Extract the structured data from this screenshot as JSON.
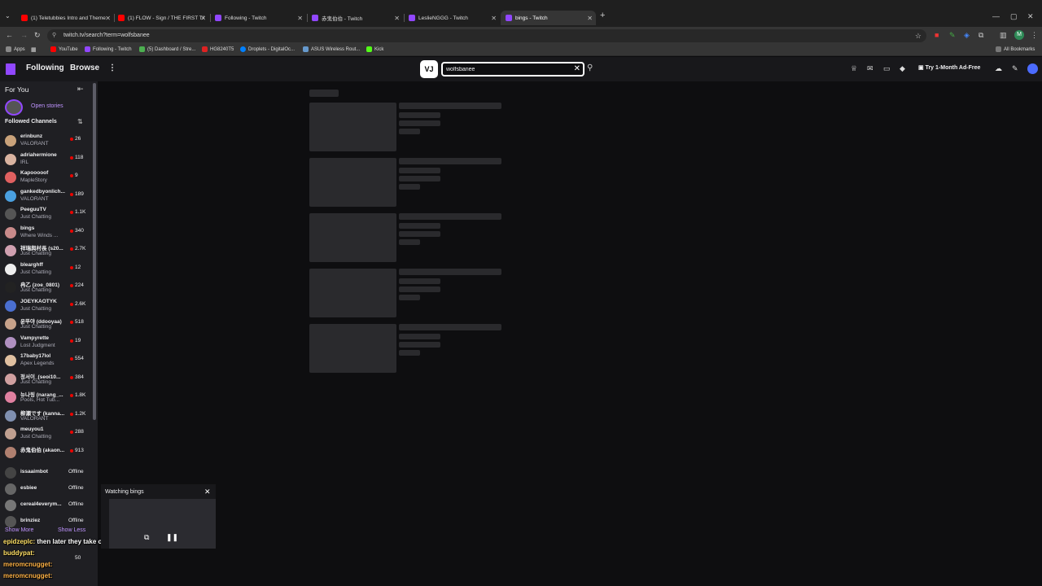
{
  "browser": {
    "tabs": [
      {
        "label": "(1) Teletubbies Intro and Theme",
        "color": "#ff0000"
      },
      {
        "label": "(1) FLOW - Sign / THE FIRST TAKE",
        "color": "#ff0000"
      },
      {
        "label": "Following - Twitch",
        "color": "#9147ff"
      },
      {
        "label": "赤鬼伯伯 - Twitch",
        "color": "#9147ff"
      },
      {
        "label": "LeslieNGGG - Twitch",
        "color": "#9147ff"
      },
      {
        "label": "bings - Twitch",
        "color": "#9147ff"
      }
    ],
    "url": "twitch.tv/search?term=wolfsbanee",
    "profile_initial": "M",
    "bookmarks": [
      {
        "label": "Apps"
      },
      {
        "label": "YouTube"
      },
      {
        "label": "Following - Twitch"
      },
      {
        "label": "(5) Dashboard / Stre..."
      },
      {
        "label": "HG8240T5"
      },
      {
        "label": "Droplets - DigitalOc..."
      },
      {
        "label": "ASUS Wireless Rout..."
      },
      {
        "label": "Kick"
      }
    ],
    "all_bookmarks": "All Bookmarks"
  },
  "nav": {
    "following": "Following",
    "browse": "Browse",
    "more": "⋮",
    "search_value": "wolfsbanee",
    "search_placeholder": "Search",
    "ad_free": "Try 1-Month Ad-Free",
    "badge": "VJ"
  },
  "sidebar": {
    "for_you": "For You",
    "open_stories": "Open stories",
    "followed_channels": "Followed Channels",
    "channels": [
      {
        "name": "erinbunz",
        "game": "VALORANT",
        "viewers": "26",
        "av": "#c9a27a"
      },
      {
        "name": "adriahermione",
        "game": "IRL",
        "viewers": "118",
        "av": "#d9b3a0"
      },
      {
        "name": "Kapooooof",
        "game": "MapleStory",
        "viewers": "9",
        "av": "#e06060"
      },
      {
        "name": "gankedbyonlich...",
        "game": "VALORANT",
        "viewers": "189",
        "av": "#4aa0e0"
      },
      {
        "name": "PeeguuTV",
        "game": "Just Chatting",
        "viewers": "1.1K",
        "av": "#555555"
      },
      {
        "name": "bings",
        "game": "Where Winds ...",
        "viewers": "340",
        "av": "#c98a8a"
      },
      {
        "name": "祥瑞與村長 (s20...",
        "game": "Just Chatting",
        "viewers": "2.7K",
        "av": "#d0a0b0"
      },
      {
        "name": "blearghff",
        "game": "Just Chatting",
        "viewers": "12",
        "av": "#eeeeee"
      },
      {
        "name": "冉乙 (zoe_0801)",
        "game": "Just Chatting",
        "viewers": "224",
        "av": "#222222"
      },
      {
        "name": "JOEYKAOTYK",
        "game": "Just Chatting",
        "viewers": "2.6K",
        "av": "#4a6fd0"
      },
      {
        "name": "윤뚜야 (ddooyaa)",
        "game": "Just Chatting",
        "viewers": "518",
        "av": "#c7a28a"
      },
      {
        "name": "Vampyrette",
        "game": "Lost Judgment",
        "viewers": "19",
        "av": "#b090c0"
      },
      {
        "name": "17baby17lol",
        "game": "Apex Legends",
        "viewers": "554",
        "av": "#e0c0a0"
      },
      {
        "name": "정서이_(seoi10...",
        "game": "Just Chatting",
        "viewers": "384",
        "av": "#d0a0a0"
      },
      {
        "name": "뉴나링 (narang_...",
        "game": "Pools, Hot Tub...",
        "viewers": "1.8K",
        "av": "#e080a0"
      },
      {
        "name": "柳瀬です (kanna...",
        "game": "VALORANT",
        "viewers": "1.2K",
        "av": "#8090b0"
      },
      {
        "name": "meuyou1",
        "game": "Just Chatting",
        "viewers": "288",
        "av": "#c0a090"
      },
      {
        "name": "赤鬼伯伯 (akaon...",
        "game": "",
        "viewers": "913",
        "av": "#b08070"
      }
    ],
    "offline": [
      {
        "name": "issaaimbot",
        "status": "Offline",
        "av": "#444444"
      },
      {
        "name": "esbiee",
        "status": "Offline",
        "av": "#666666"
      },
      {
        "name": "cereal4everym...",
        "status": "Offline",
        "av": "#777777"
      },
      {
        "name": "brinziez",
        "status": "Offline",
        "av": "#555555"
      }
    ],
    "show_more": "Show More",
    "show_less": "Show Less",
    "partial_viewers": "50"
  },
  "chat_overlay": [
    {
      "user": "epidzeplc:",
      "msg": "then later they take off",
      "color": "#ffe066"
    },
    {
      "user": "buddypat:",
      "msg": "",
      "color": "#ffe066"
    },
    {
      "user": "meromcnugget:",
      "msg": "",
      "color": "#ffb347"
    },
    {
      "user": "meromcnugget:",
      "msg": "",
      "color": "#ffb347"
    }
  ],
  "miniplayer": {
    "title": "Watching bings"
  }
}
